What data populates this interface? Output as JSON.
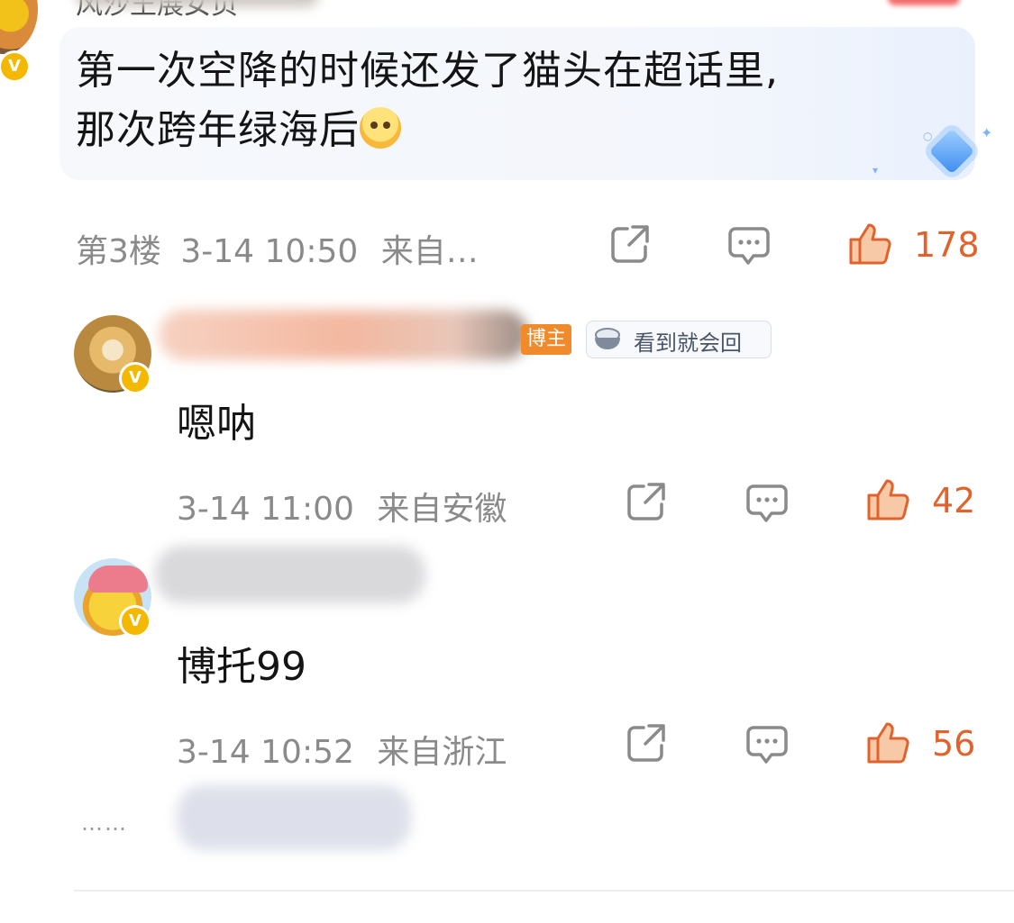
{
  "top_comment": {
    "username_partial": "风沙王展女页",
    "text_line1": "第一次空降的时候还发了猫头在超话里,",
    "text_line2": "那次跨年绿海后",
    "emoji_icon": "holding-back-tears-emoji",
    "floor": "第3楼",
    "time": "3-14 10:50",
    "source": "来自…",
    "like_count": "178"
  },
  "replies": [
    {
      "role_tag": "博主",
      "badge_label": "看到就会回",
      "badge_icon": "rice-bowl-icon",
      "text": "嗯呐",
      "time": "3-14 11:00",
      "source": "来自安徽",
      "like_count": "42"
    },
    {
      "text": "博托99",
      "time": "3-14 10:52",
      "source": "来自浙江",
      "like_count": "56"
    }
  ],
  "more_indicator": "……",
  "icons": {
    "share": "share-icon",
    "comment": "comment-icon",
    "like": "thumbs-up-icon",
    "verified": "verified-badge-icon"
  },
  "colors": {
    "like_accent": "#e0622c",
    "verified_badge": "#f5b800",
    "blogger_tag": "#f08a2a",
    "bubble_bg": "#f3f6fc"
  }
}
